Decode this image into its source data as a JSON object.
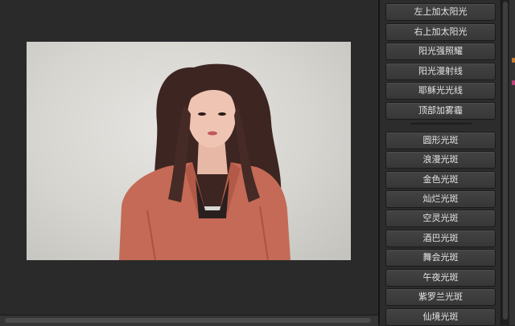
{
  "panel": {
    "buttons": [
      "左上加太阳光",
      "右上加太阳光",
      "阳光强照耀",
      "阳光漫射线",
      "耶稣光光线",
      "顶部加雾霾",
      "圆形光斑",
      "浪漫光斑",
      "金色光斑",
      "灿烂光斑",
      "空灵光斑",
      "酒巴光斑",
      "舞会光斑",
      "午夜光斑",
      "紫罗兰光斑",
      "仙境光斑"
    ]
  },
  "colors": {
    "jacket": "#c46a56",
    "hair": "#3d2521",
    "background": "#262626"
  }
}
